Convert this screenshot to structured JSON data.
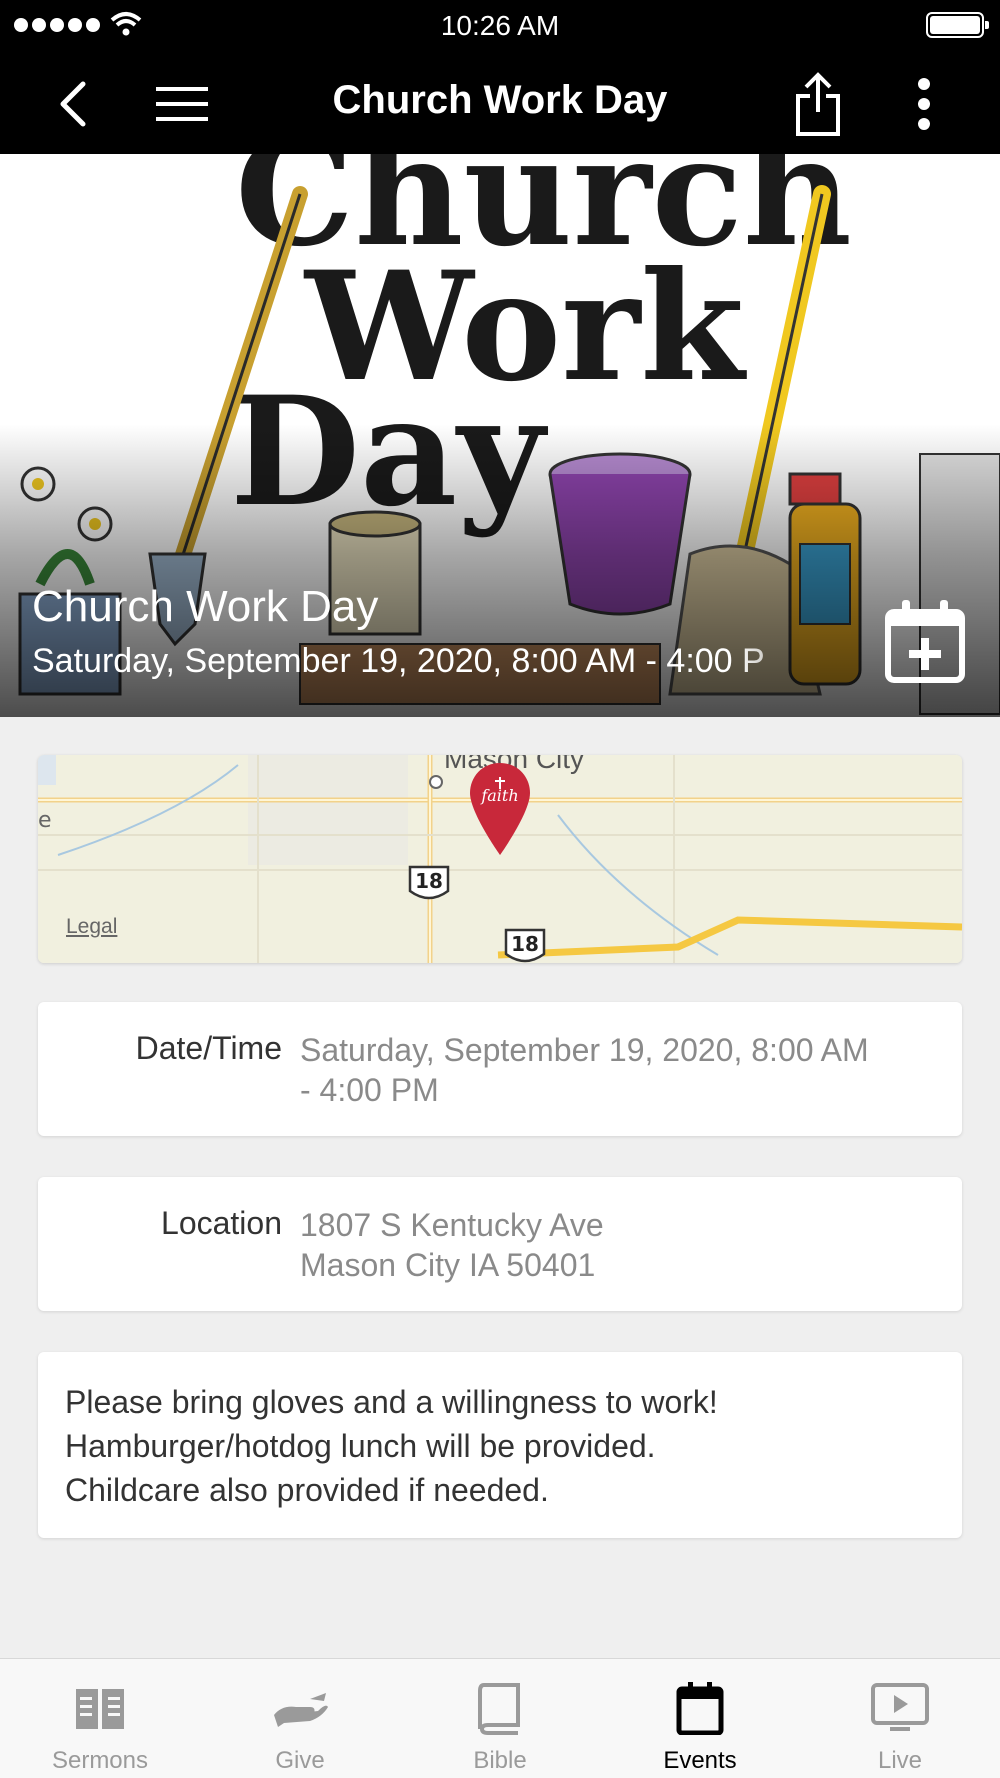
{
  "status_bar": {
    "time": "10:26 AM"
  },
  "nav": {
    "title": "Church Work Day"
  },
  "hero": {
    "title": "Church Work Day",
    "subtitle": "Saturday, September 19, 2020, 8:00 AM - 4:00 P",
    "image_text": [
      "Church",
      "Work",
      "Day"
    ]
  },
  "map": {
    "city_label": "Mason City",
    "route_shield": "18",
    "pin_label": "faith",
    "legal_label": "Legal"
  },
  "details": {
    "datetime_label": "Date/Time",
    "datetime_line1": "Saturday, September 19, 2020, 8:00 AM",
    "datetime_line2": "- 4:00 PM",
    "location_label": "Location",
    "location_line1": "1807 S Kentucky Ave",
    "location_line2": "Mason City IA 50401"
  },
  "description": {
    "line1": "Please bring gloves and a willingness to work!",
    "line2": "Hamburger/hotdog lunch will be provided.",
    "line3": "Childcare also provided if needed."
  },
  "tabs": [
    {
      "label": "Sermons",
      "icon": "open-book-icon",
      "active": false
    },
    {
      "label": "Give",
      "icon": "giving-hand-icon",
      "active": false
    },
    {
      "label": "Bible",
      "icon": "bible-icon",
      "active": false
    },
    {
      "label": "Events",
      "icon": "calendar-icon",
      "active": true
    },
    {
      "label": "Live",
      "icon": "play-screen-icon",
      "active": false
    }
  ],
  "colors": {
    "bar_background": "#000000",
    "page_background": "#efefef",
    "pin": "#c8283a",
    "active_tab": "#000000",
    "inactive_tab": "#9a9a9a"
  }
}
